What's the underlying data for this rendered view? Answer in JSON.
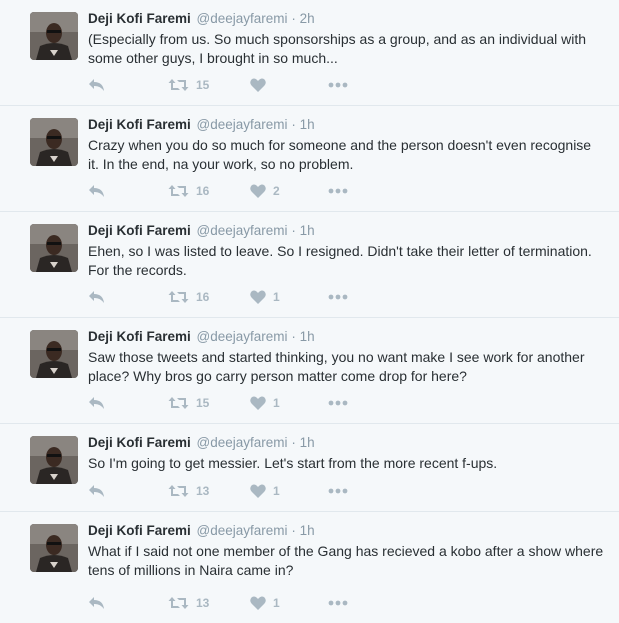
{
  "tweets": [
    {
      "name": "Deji Kofi Faremi",
      "handle": "@deejayfaremi",
      "sep": "·",
      "time": "2h",
      "text": "(Especially from us. So much sponsorships as a group, and as an individual with some other guys, I brought in so much...",
      "retweets": "15",
      "likes": ""
    },
    {
      "name": "Deji Kofi Faremi",
      "handle": "@deejayfaremi",
      "sep": "·",
      "time": "1h",
      "text": "Crazy when you do so much for someone and the person doesn't even recognise it. In the end, na your work, so no problem.",
      "retweets": "16",
      "likes": "2"
    },
    {
      "name": "Deji Kofi Faremi",
      "handle": "@deejayfaremi",
      "sep": "·",
      "time": "1h",
      "text": "Ehen, so I was listed to leave. So I resigned. Didn't take their letter of termination. For the records.",
      "retweets": "16",
      "likes": "1"
    },
    {
      "name": "Deji Kofi Faremi",
      "handle": "@deejayfaremi",
      "sep": "·",
      "time": "1h",
      "text": "Saw those tweets and started thinking, you no want make I see work for another place? Why bros go carry person matter come drop for here?",
      "retweets": "15",
      "likes": "1"
    },
    {
      "name": "Deji Kofi Faremi",
      "handle": "@deejayfaremi",
      "sep": "·",
      "time": "1h",
      "text": "So I'm going to get messier. Let's start from the more recent f-ups.",
      "retweets": "13",
      "likes": "1"
    },
    {
      "name": "Deji Kofi Faremi",
      "handle": "@deejayfaremi",
      "sep": "·",
      "time": "1h",
      "text": "What if I said not one member of the Gang has recieved a kobo after a show where tens of millions in Naira came in?",
      "retweets": "13",
      "likes": "1"
    }
  ],
  "icons": {
    "reply": "reply-icon",
    "retweet": "retweet-icon",
    "like": "heart-icon",
    "more": "more-dots-icon"
  },
  "colors": {
    "background": "#f5f8fa",
    "text": "#292f33",
    "muted": "#8899a6",
    "icon": "#aab8c2",
    "divider": "#e1e8ed"
  }
}
